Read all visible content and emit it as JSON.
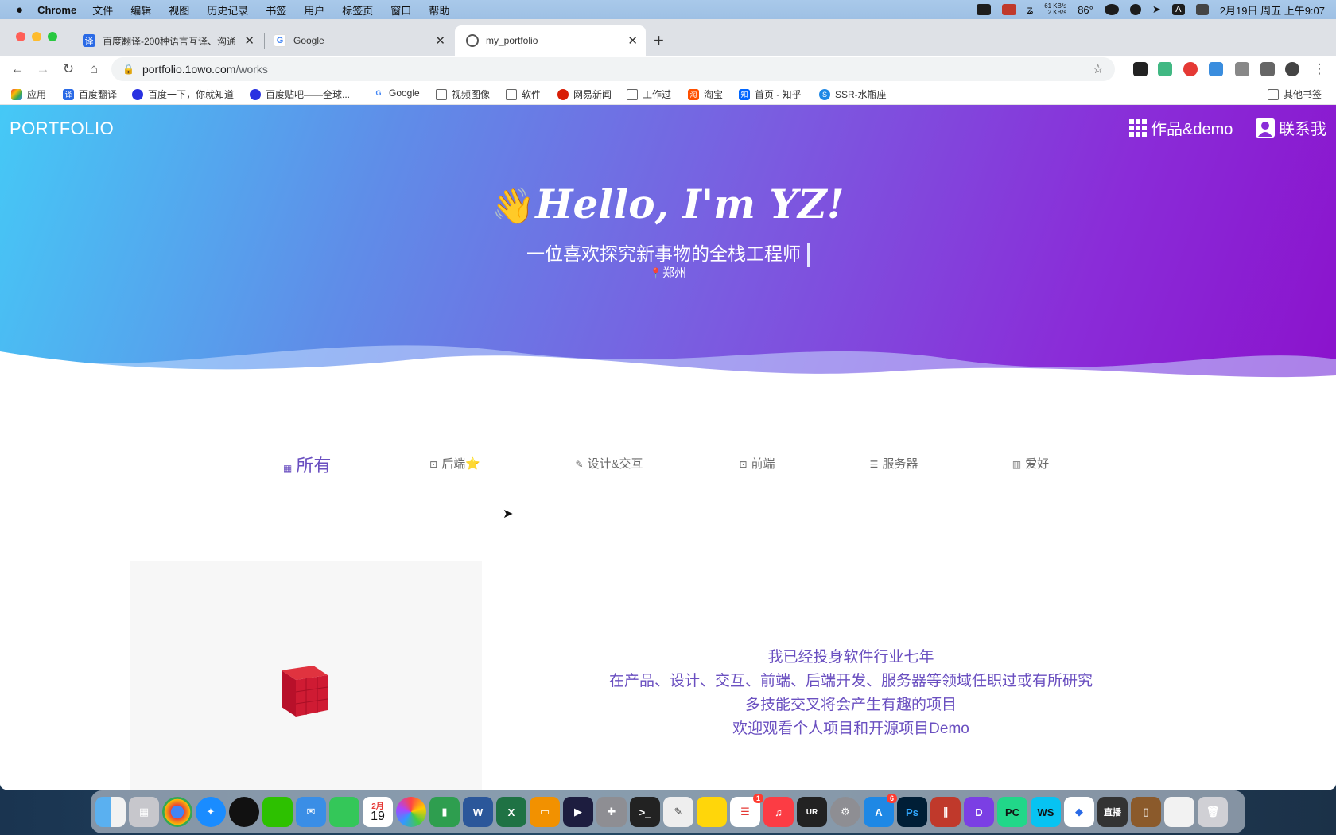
{
  "menubar": {
    "apple": "",
    "app_name": "Chrome",
    "menus": [
      "文件",
      "编辑",
      "视图",
      "历史记录",
      "书签",
      "用户",
      "标签页",
      "窗口",
      "帮助"
    ],
    "net_up": "61 KB/s",
    "net_down": "2 KB/s",
    "temperature": "86°",
    "datetime": "2月19日 周五 上午9:07"
  },
  "tabs": [
    {
      "title": "百度翻译-200种语言互译、沟通",
      "icon": "translate-icon",
      "close": "✕"
    },
    {
      "title": "Google",
      "icon": "google-icon",
      "close": "✕"
    },
    {
      "title": "my_portfolio",
      "icon": "portfolio-icon",
      "close": "✕"
    }
  ],
  "new_tab": "+",
  "omnibox": {
    "host": "portfolio.1owo.com",
    "path": "/works"
  },
  "bookmarks": [
    {
      "label": "应用",
      "icon": "apps-icon"
    },
    {
      "label": "百度翻译",
      "icon": "translate-icon"
    },
    {
      "label": "百度一下，你就知道",
      "icon": "baidu-icon"
    },
    {
      "label": "百度贴吧——全球...",
      "icon": "baidu-icon"
    },
    {
      "label": "Google",
      "icon": "google-icon"
    },
    {
      "label": "视频图像",
      "icon": "folder-icon"
    },
    {
      "label": "软件",
      "icon": "folder-icon"
    },
    {
      "label": "网易新闻",
      "icon": "netease-icon"
    },
    {
      "label": "工作过",
      "icon": "folder-icon"
    },
    {
      "label": "淘宝",
      "icon": "taobao-icon"
    },
    {
      "label": "首页 - 知乎",
      "icon": "zhihu-icon"
    },
    {
      "label": "SSR-水瓶座",
      "icon": "ssr-icon"
    }
  ],
  "other_bookmarks": "其他书签",
  "page": {
    "brand": "PORTFOLIO",
    "nav": {
      "works": "作品&demo",
      "contact": "联系我"
    },
    "hero": {
      "wave_emoji": "👋",
      "greeting": "Hello, I'm YZ!",
      "subtitle": "一位喜欢探究新事物的全栈工程师",
      "location": "郑州"
    },
    "filters": [
      {
        "label": "所有",
        "active": true
      },
      {
        "label": "后端⭐",
        "active": false
      },
      {
        "label": "设计&交互",
        "active": false
      },
      {
        "label": "前端",
        "active": false
      },
      {
        "label": "服务器",
        "active": false
      },
      {
        "label": "爱好",
        "active": false
      }
    ],
    "intro": [
      "我已经投身软件行业七年",
      "在产品、设计、交互、前端、后端开发、服务器等领域任职过或有所研究",
      "多技能交叉将会产生有趣的项目",
      "欢迎观看个人项目和开源项目Demo"
    ]
  },
  "colors": {
    "accent": "#6a4fc0",
    "hero_start": "#45c9f6",
    "hero_end": "#8b12cc",
    "cube": "#c8102e"
  },
  "dock": {
    "calendar_month": "2月",
    "calendar_day": "19",
    "reminders_badge": "1",
    "appstore_badge": "6",
    "live_label": "直播"
  }
}
